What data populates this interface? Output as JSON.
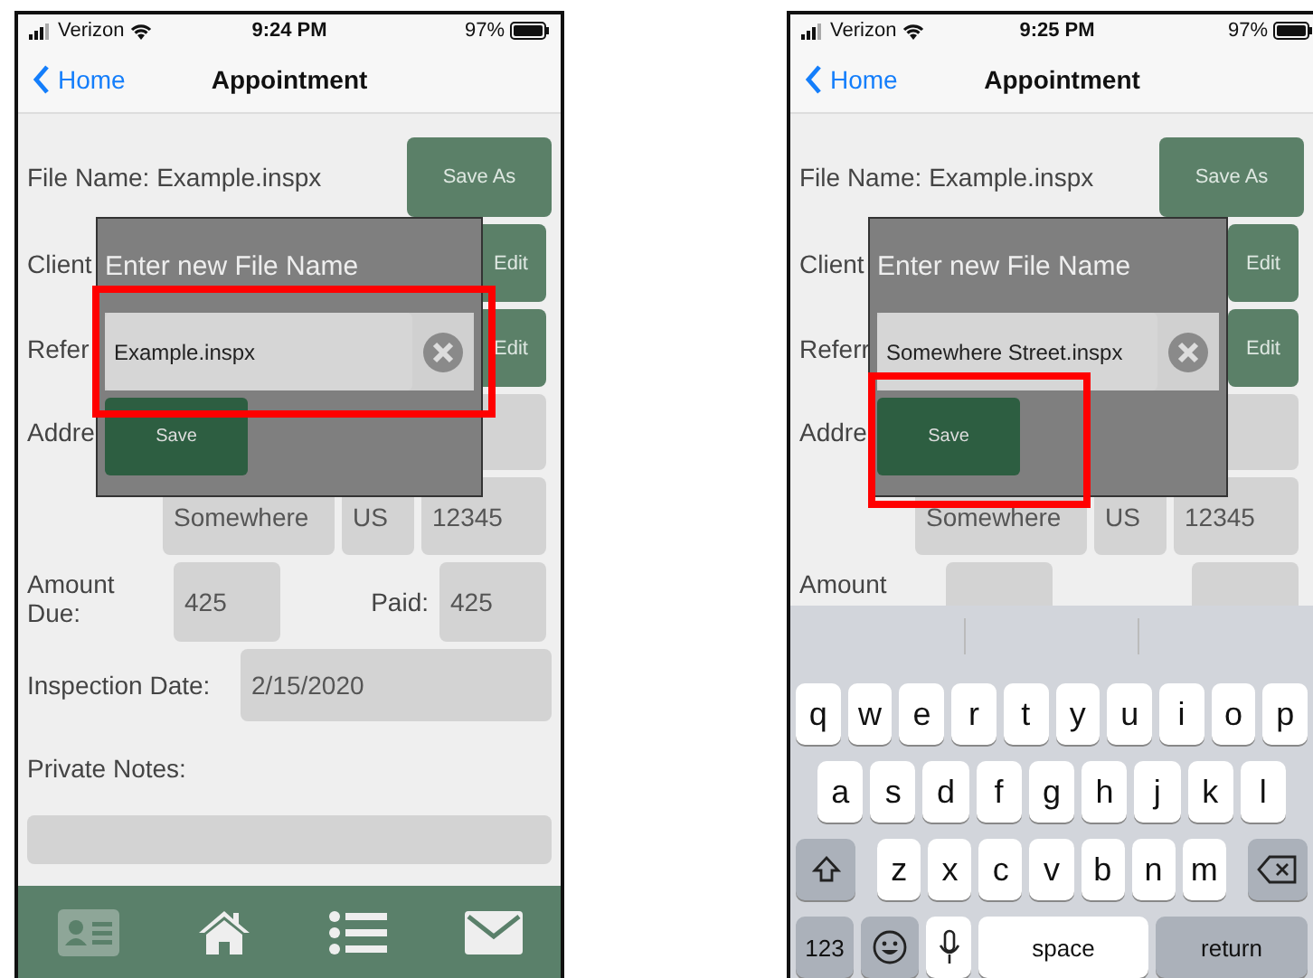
{
  "phones": [
    {
      "status": {
        "carrier": "Verizon",
        "time": "9:24 PM",
        "battery": "97%"
      },
      "nav": {
        "back": "Home",
        "title": "Appointment"
      },
      "rows": [
        {
          "kind": "file",
          "label": "File Name: Example.inspx",
          "button": "Save As"
        },
        {
          "kind": "edit",
          "label": "Client",
          "button": "Edit"
        },
        {
          "kind": "edit",
          "label": "Refer",
          "button": "Edit"
        },
        {
          "kind": "field",
          "label": "Addre"
        },
        {
          "kind": "address",
          "fields": [
            "Somewhere",
            "US",
            "12345"
          ]
        },
        {
          "kind": "amount",
          "label": "Amount Due:",
          "value": "425",
          "paid_label": "Paid:",
          "paid_value": "425"
        },
        {
          "kind": "date",
          "label": "Inspection Date:",
          "value": "2/15/2020"
        },
        {
          "kind": "notes",
          "label": "Private Notes:"
        }
      ],
      "dialog": {
        "title": "Enter new File Name",
        "value": "Example.inspx",
        "value_highlighted": true,
        "save": "Save",
        "save_highlighted": false
      },
      "bottom": {
        "kind": "tabs",
        "tabs": [
          {
            "selected": true
          },
          {
            "selected": false
          },
          {
            "selected": false
          },
          {
            "selected": false
          }
        ]
      }
    },
    {
      "status": {
        "carrier": "Verizon",
        "time": "9:25 PM",
        "battery": "97%"
      },
      "nav": {
        "back": "Home",
        "title": "Appointment"
      },
      "rows": [
        {
          "kind": "file",
          "label": "File Name: Example.inspx",
          "button": "Save As"
        },
        {
          "kind": "edit",
          "label": "Client",
          "button": "Edit"
        },
        {
          "kind": "edit",
          "label": "Referr",
          "button": "Edit"
        },
        {
          "kind": "field",
          "label": "Addre"
        },
        {
          "kind": "address",
          "fields": [
            "Somewhere",
            "US",
            "12345"
          ]
        },
        {
          "kind": "amount",
          "label": "Amount"
        }
      ],
      "dialog": {
        "title": "Enter new File Name",
        "value": "Somewhere Street.inspx",
        "value_highlighted": false,
        "save": "Save",
        "save_highlighted": true
      },
      "bottom": {
        "kind": "keyboard",
        "rows": [
          {
            "keys": [
              {
                "kind": "letter",
                "label": "q"
              },
              {
                "kind": "letter",
                "label": "w"
              },
              {
                "kind": "letter",
                "label": "e"
              },
              {
                "kind": "letter",
                "label": "r"
              },
              {
                "kind": "letter",
                "label": "t"
              },
              {
                "kind": "letter",
                "label": "y"
              },
              {
                "kind": "letter",
                "label": "u"
              },
              {
                "kind": "letter",
                "label": "i"
              },
              {
                "kind": "letter",
                "label": "o"
              },
              {
                "kind": "letter",
                "label": "p"
              }
            ]
          },
          {
            "keys": [
              {
                "kind": "letter",
                "label": "a"
              },
              {
                "kind": "letter",
                "label": "s"
              },
              {
                "kind": "letter",
                "label": "d"
              },
              {
                "kind": "letter",
                "label": "f"
              },
              {
                "kind": "letter",
                "label": "g"
              },
              {
                "kind": "letter",
                "label": "h"
              },
              {
                "kind": "letter",
                "label": "j"
              },
              {
                "kind": "letter",
                "label": "k"
              },
              {
                "kind": "letter",
                "label": "l"
              }
            ]
          },
          {
            "keys": [
              {
                "kind": "shift"
              },
              {
                "kind": "letter",
                "label": "z"
              },
              {
                "kind": "letter",
                "label": "x"
              },
              {
                "kind": "letter",
                "label": "c"
              },
              {
                "kind": "letter",
                "label": "v"
              },
              {
                "kind": "letter",
                "label": "b"
              },
              {
                "kind": "letter",
                "label": "n"
              },
              {
                "kind": "letter",
                "label": "m"
              },
              {
                "kind": "backspace"
              }
            ]
          },
          {
            "keys": [
              {
                "kind": "mode",
                "label": "123"
              },
              {
                "kind": "emoji"
              },
              {
                "kind": "mic"
              },
              {
                "kind": "space",
                "label": "space"
              },
              {
                "kind": "return",
                "label": "return"
              }
            ]
          }
        ]
      }
    }
  ]
}
